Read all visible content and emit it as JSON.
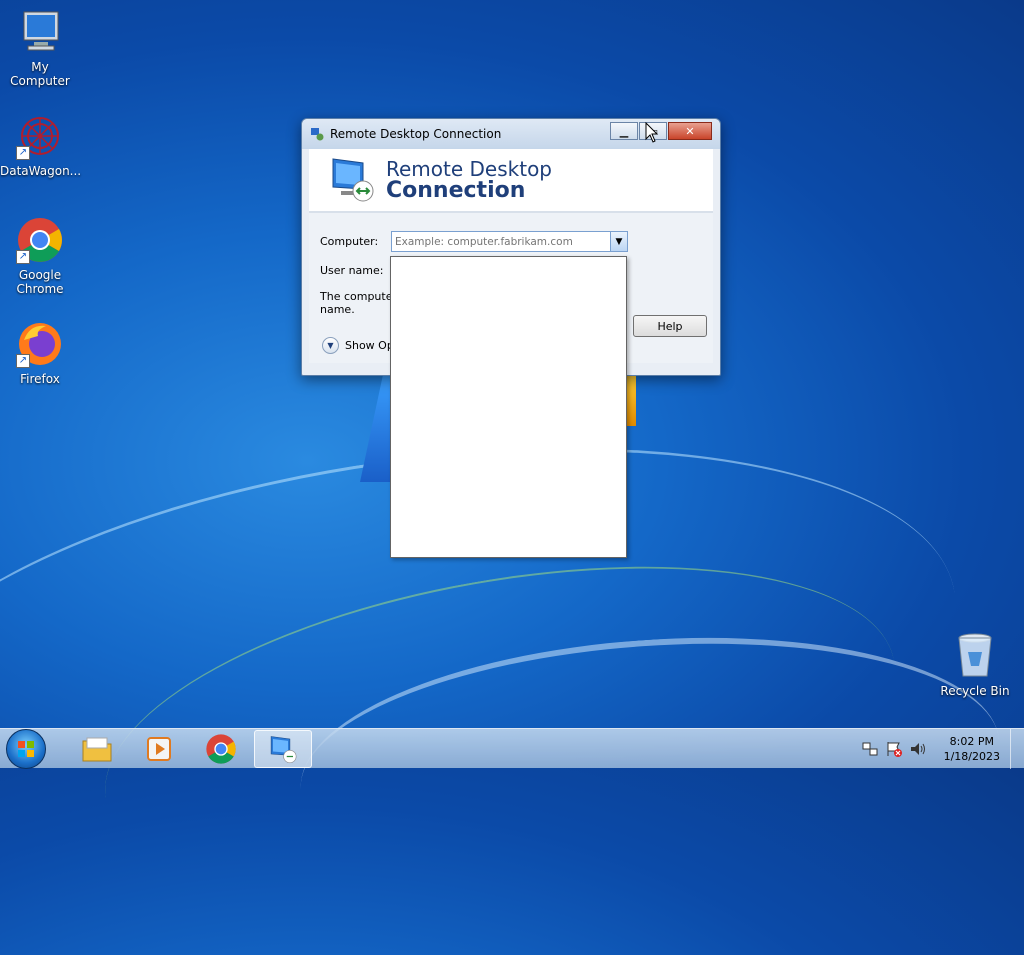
{
  "desktop": {
    "icons": [
      {
        "label": "My Computer"
      },
      {
        "label": "DataWagon..."
      },
      {
        "label": "Google Chrome"
      },
      {
        "label": "Firefox"
      },
      {
        "label": "Recycle Bin"
      }
    ]
  },
  "window": {
    "title": "Remote Desktop Connection",
    "banner_line1": "Remote Desktop",
    "banner_line2": "Connection",
    "computer_label": "Computer:",
    "computer_placeholder": "Example: computer.fabrikam.com",
    "username_label": "User name:",
    "info_line1": "The computer n",
    "info_line2": "name.",
    "show_options": "Show Opt",
    "help_label": "Help",
    "minimize_glyph": "▁",
    "maximize_glyph": "▭",
    "close_glyph": "✕"
  },
  "taskbar": {
    "time": "8:02 PM",
    "date": "1/18/2023"
  }
}
